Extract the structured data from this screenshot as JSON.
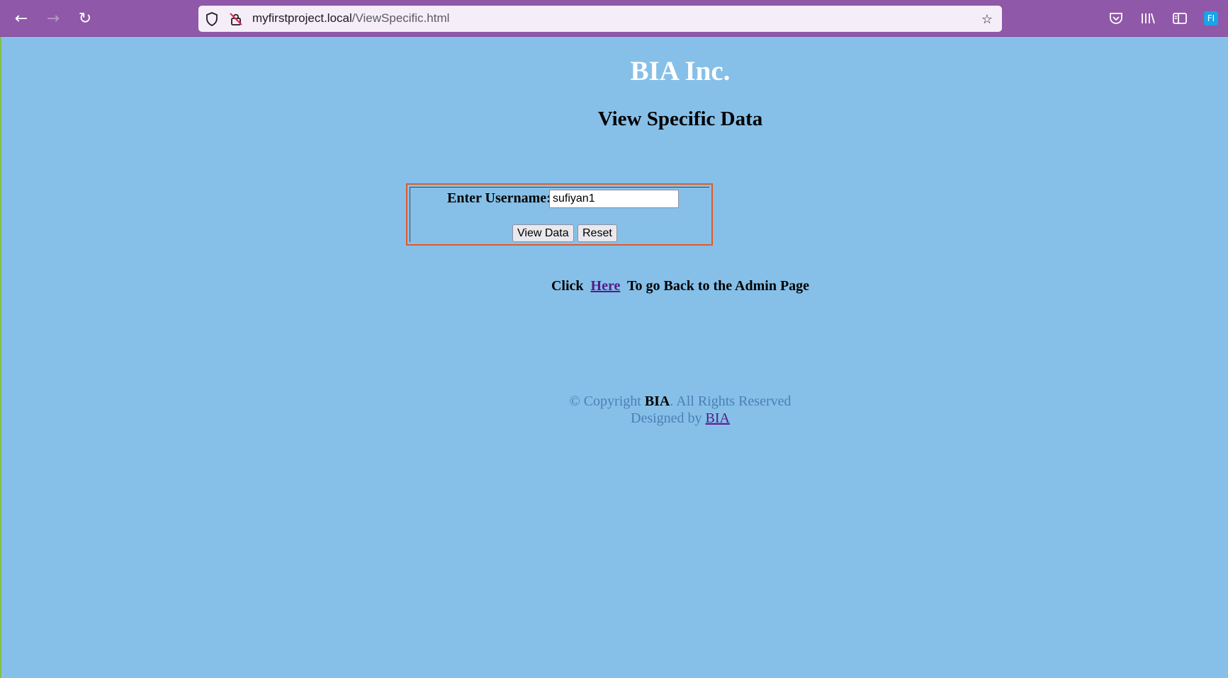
{
  "browser": {
    "url_host": "myfirstproject.local",
    "url_path": "/ViewSpecific.html",
    "icons": {
      "back": "back-arrow-icon",
      "forward": "forward-arrow-icon",
      "reload": "reload-icon",
      "shield": "shield-icon",
      "insecure": "insecure-lock-icon",
      "bookmark": "star-icon",
      "pocket": "pocket-icon",
      "library": "library-icon",
      "reader": "sidebar-icon",
      "account": "account-icon"
    },
    "account_initials": "FI"
  },
  "page": {
    "brand": "BIA Inc.",
    "heading": "View Specific Data",
    "form": {
      "label": "Enter Username:",
      "username_value": "sufiyan1",
      "view_button": "View Data",
      "reset_button": "Reset"
    },
    "back_link": {
      "prefix": "Click  ",
      "link_text": "Here",
      "suffix": "  To go Back to the Admin Page"
    },
    "footer": {
      "copyright_prefix": "© Copyright ",
      "copyright_brand": "BIA",
      "copyright_suffix": ". All Rights Reserved",
      "designed_prefix": "Designed by ",
      "designed_link": "BIA"
    }
  },
  "colors": {
    "page_background": "#86c0e8",
    "toolbar": "#9058a8",
    "form_border": "#e05a2a",
    "link": "#551a8b",
    "footer_text": "#4a7fb5"
  }
}
